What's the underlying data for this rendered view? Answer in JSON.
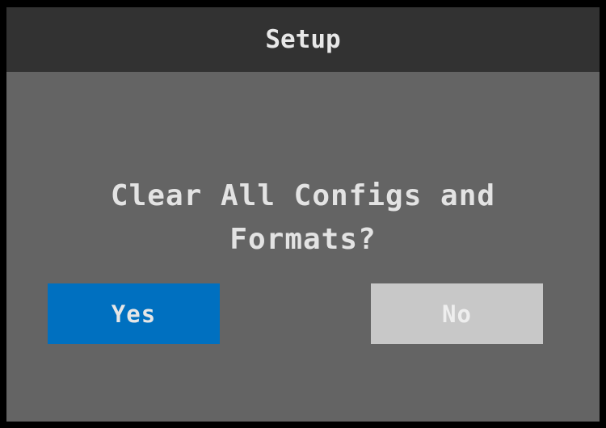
{
  "header": {
    "title": "Setup"
  },
  "dialog": {
    "message_line1": "Clear All Configs and",
    "message_line2": "Formats?"
  },
  "buttons": {
    "yes_label": "Yes",
    "no_label": "No"
  },
  "colors": {
    "background": "#646464",
    "header_bg": "#323232",
    "yes_bg": "#0070c0",
    "no_bg": "#c8c8c8"
  }
}
